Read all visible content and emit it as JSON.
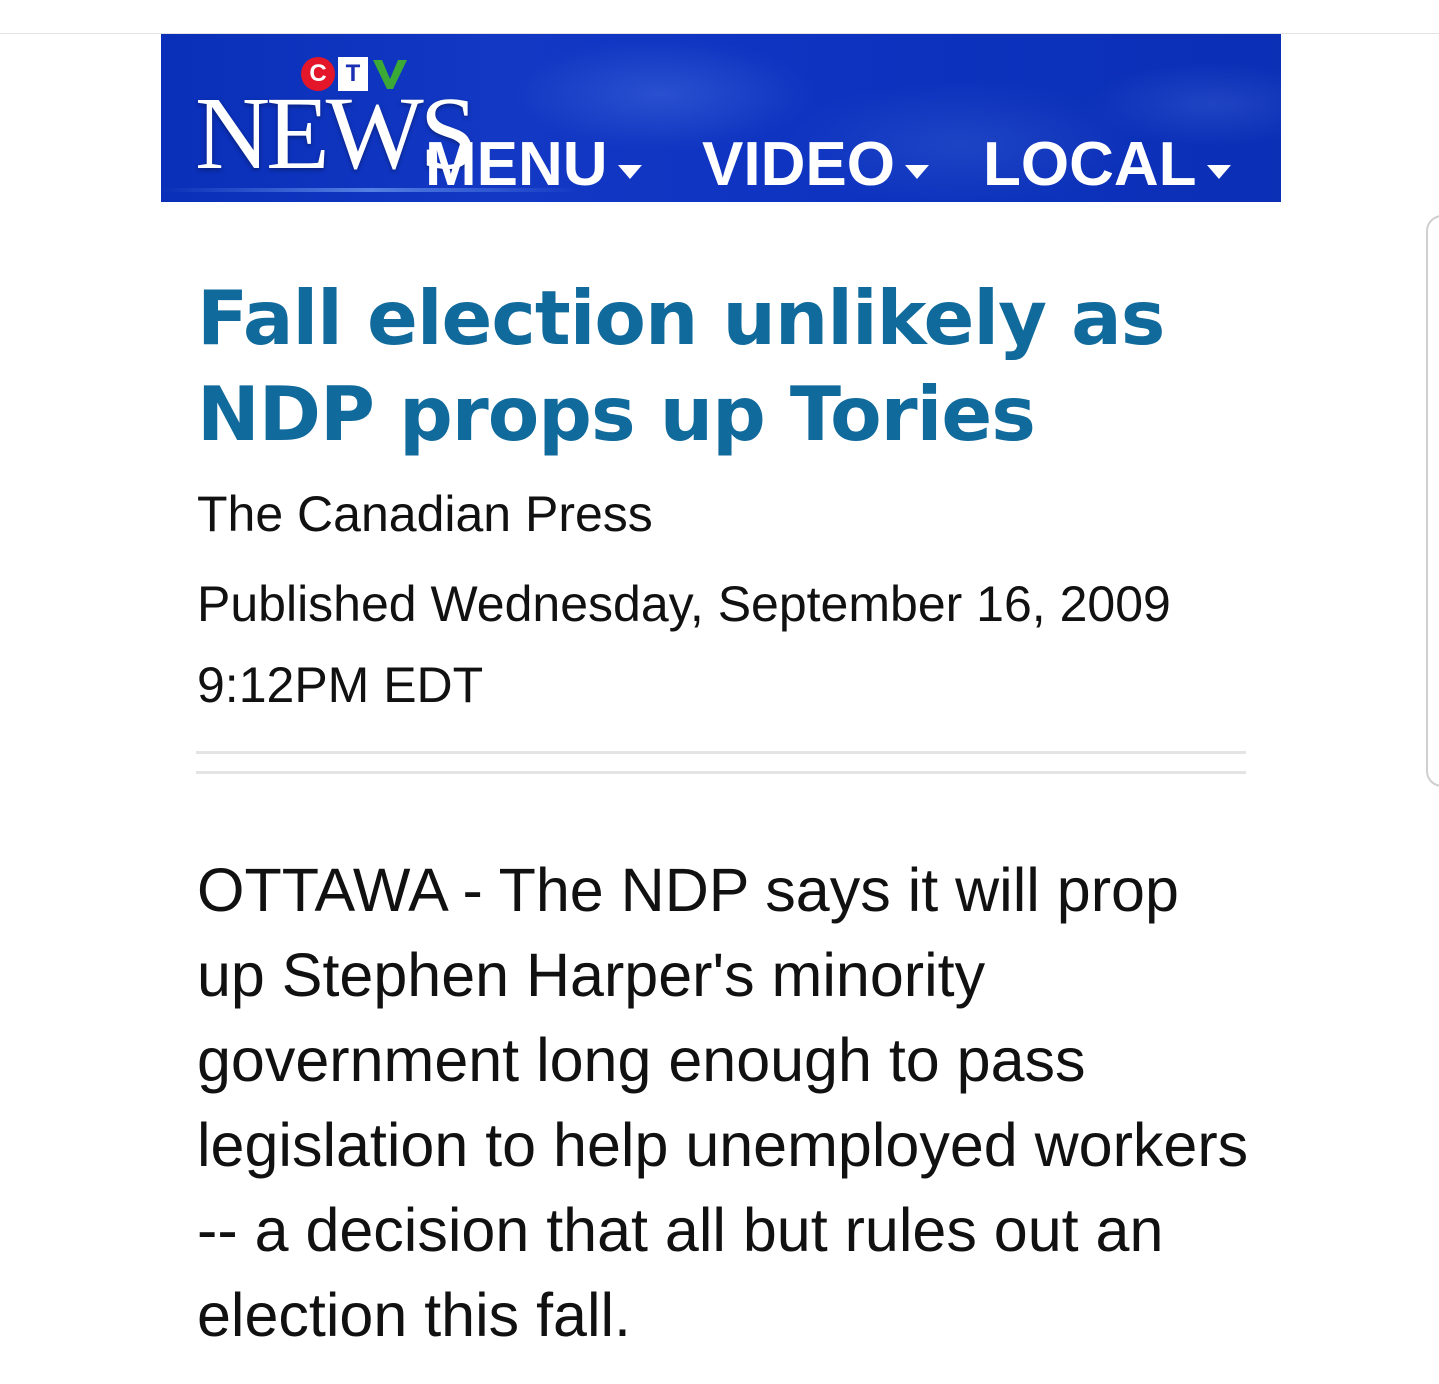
{
  "header": {
    "logo": {
      "ctv_c": "C",
      "ctv_t": "T",
      "ctv_v": "V",
      "wordmark": "NEWS",
      "colors": {
        "c": "#e3162a",
        "t": "#ffffff",
        "v": "#3aa935"
      }
    },
    "background_color": "#0d33c0",
    "nav": [
      {
        "label": "MENU",
        "icon": "chevron-down-icon"
      },
      {
        "label": "VIDEO",
        "icon": "chevron-down-icon"
      },
      {
        "label": "LOCAL",
        "icon": "chevron-down-icon"
      }
    ]
  },
  "article": {
    "headline": "Fall election unlikely as NDP props up Tories",
    "headline_color": "#116a9c",
    "source": "The Canadian Press",
    "published": "Published Wednesday, September 16, 2009 9:12PM EDT",
    "body": "OTTAWA - The NDP says it will prop up Stephen Harper's minority government long enough to pass legislation to help unemployed workers -- a decision that all but rules out an election this fall."
  }
}
